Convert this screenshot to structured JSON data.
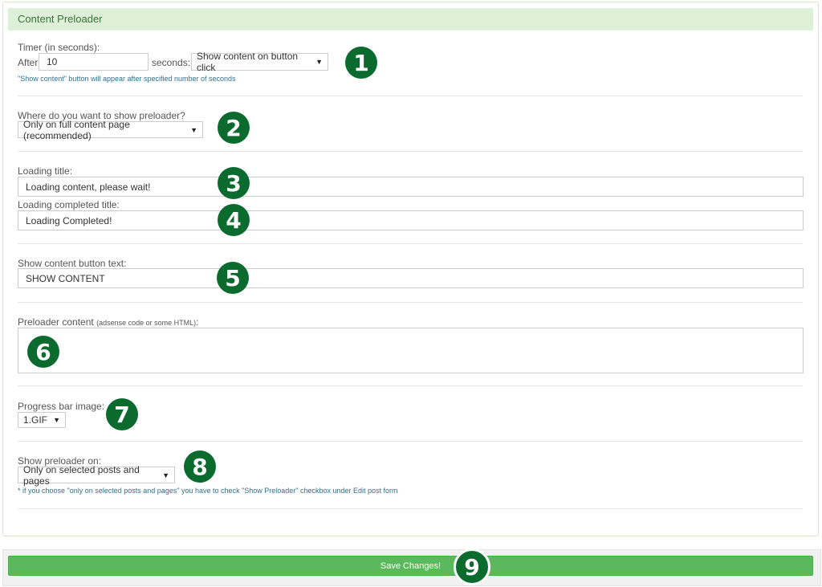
{
  "header": {
    "title": "Content Preloader"
  },
  "timer": {
    "label": "Timer (in seconds):",
    "after": "After",
    "value": "10",
    "seconds": "seconds:",
    "mode": "Show content on button click",
    "help": "\"Show content\" button will appear after specified number of seconds"
  },
  "where": {
    "label": "Where do you want to show preloader?",
    "value": "Only on full content page (recommended)"
  },
  "loading_title": {
    "label": "Loading title:",
    "value": "Loading content, please wait!"
  },
  "completed_title": {
    "label": "Loading completed title:",
    "value": "Loading Completed!"
  },
  "button_text": {
    "label": "Show content button text:",
    "value": "SHOW CONTENT"
  },
  "preloader_content": {
    "label": "Preloader content",
    "hint": "(adsense code or some HTML)",
    "colon": ":",
    "value": ""
  },
  "progress": {
    "label": "Progress bar image:",
    "value": "1.GIF"
  },
  "show_on": {
    "label": "Show preloader on:",
    "value": "Only on selected posts and pages",
    "note": "* if you choose \"only on selected posts and pages\" you have to check \"Show Preloader\" checkbox under Edit post form"
  },
  "save_label": "Save Changes!",
  "badges": [
    "1",
    "2",
    "3",
    "4",
    "5",
    "6",
    "7",
    "8",
    "9"
  ],
  "colors": {
    "header_bg": "#dff0d8",
    "badge": "#0b6b2e",
    "save": "#5cb85c"
  }
}
